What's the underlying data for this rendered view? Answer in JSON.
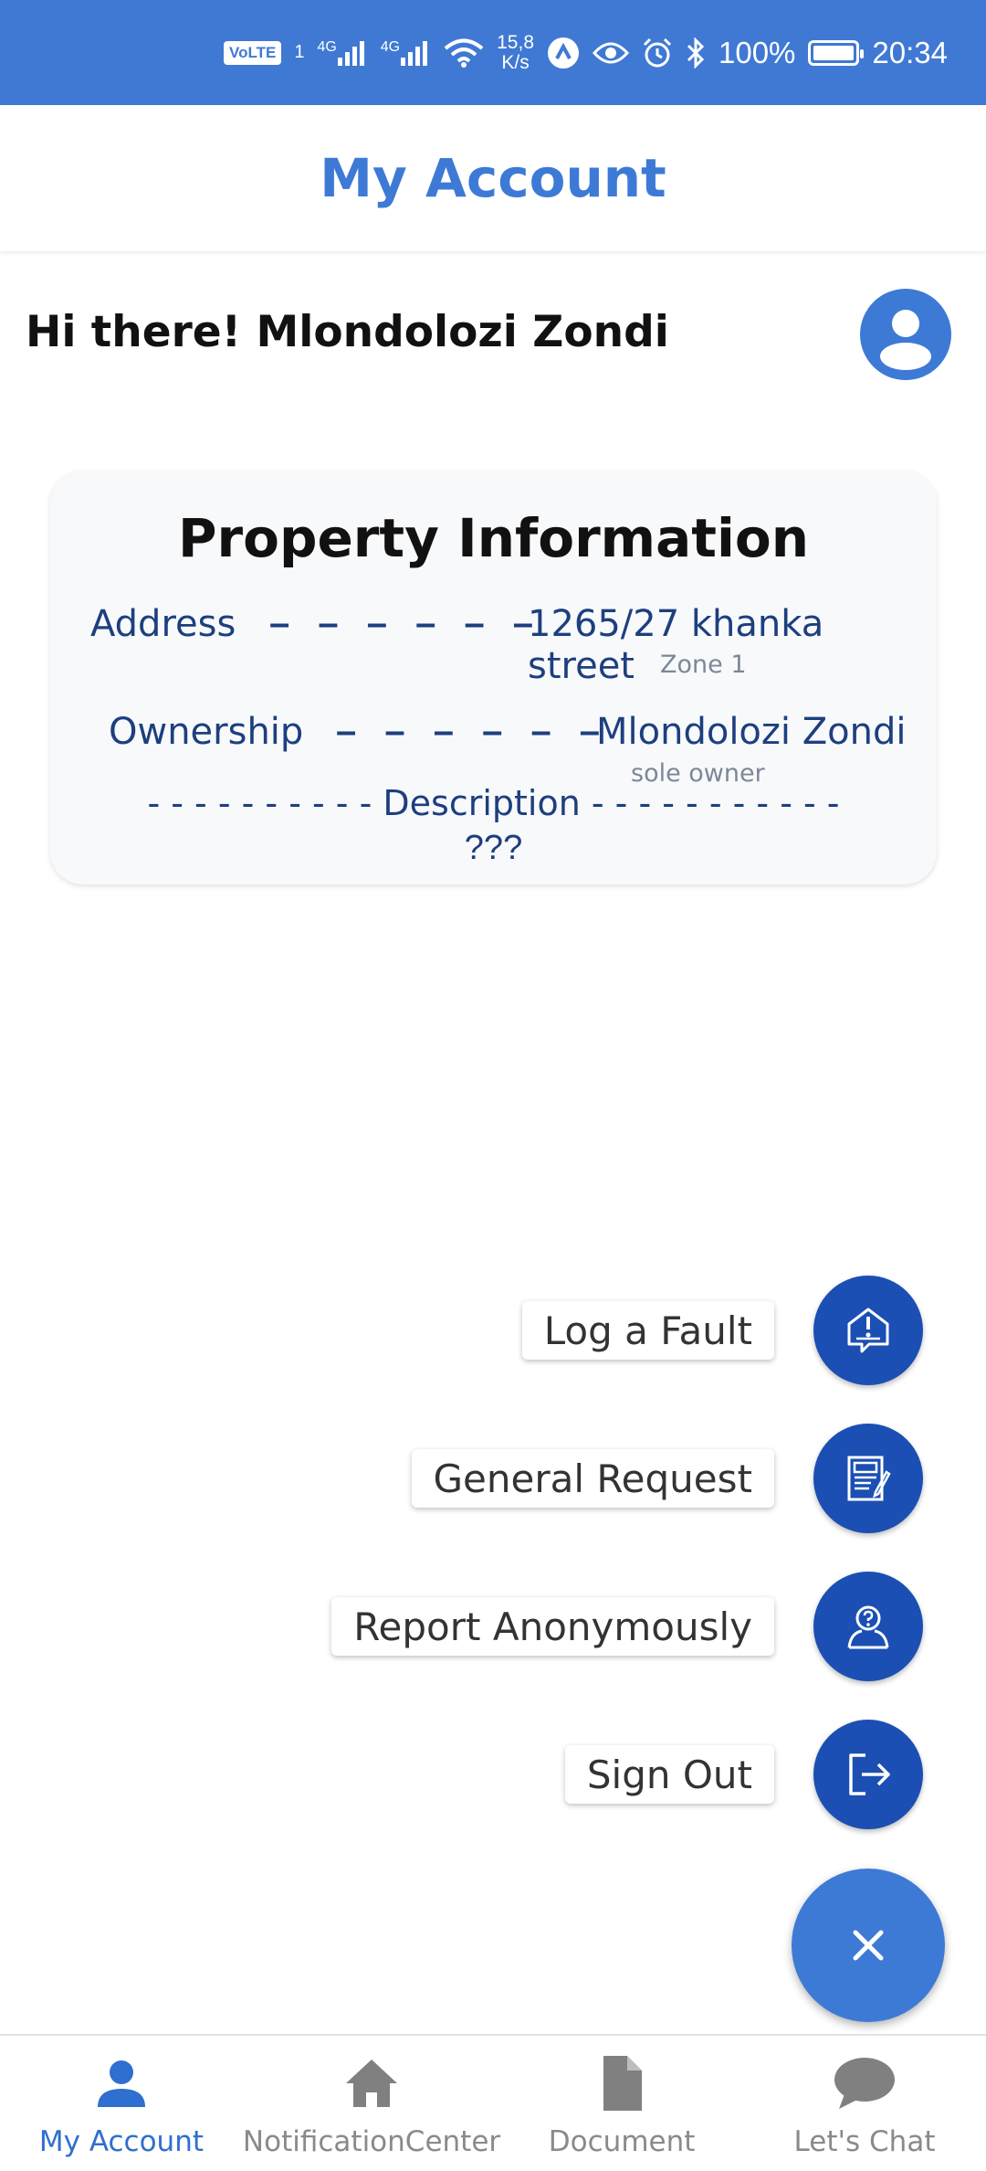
{
  "status_bar": {
    "volte": "VoLTE",
    "sim_marker": "1",
    "net1": "4G",
    "net2": "4G",
    "speed_value": "15,8",
    "speed_unit": "K/s",
    "battery": "100%",
    "time": "20:34",
    "icons": [
      "signal-icon",
      "wifi-icon",
      "app-notification-icon",
      "eye-icon",
      "alarm-icon",
      "bluetooth-icon",
      "battery-icon"
    ]
  },
  "header": {
    "title": "My Account"
  },
  "greeting": {
    "text": "Hi there! Mlondolozi Zondi"
  },
  "property": {
    "title": "Property Information",
    "address_label": "Address",
    "address_dashes": "– – – – – –",
    "address_value": "1265/27 khanka street",
    "address_sub": "Zone 1",
    "ownership_label": "Ownership",
    "ownership_dashes": "– – – – – –",
    "ownership_value": "Mlondolozi Zondi",
    "ownership_sub": "sole owner",
    "description_line": "- - - - - - - - - - Description - - - - - - - - - - -",
    "description_value": "???"
  },
  "fab_menu": {
    "items": [
      {
        "label": "Log a Fault",
        "icon": "fault-alert-icon"
      },
      {
        "label": "General Request",
        "icon": "request-form-icon"
      },
      {
        "label": "Report Anonymously",
        "icon": "anonymous-person-icon"
      },
      {
        "label": "Sign Out",
        "icon": "sign-out-icon"
      }
    ],
    "close_icon": "close-icon"
  },
  "bottom_nav": {
    "items": [
      {
        "label": "My Account",
        "icon": "person-icon",
        "active": true
      },
      {
        "label": "NotificationCenter",
        "icon": "home-icon",
        "active": false
      },
      {
        "label": "Document",
        "icon": "document-icon",
        "active": false
      },
      {
        "label": "Let's Chat",
        "icon": "chat-bubble-icon",
        "active": false
      }
    ]
  },
  "colors": {
    "status_bar": "#3f79d4",
    "accent": "#3d7ad6",
    "fab_dark": "#1b4fb3",
    "card_text": "#1d3f7e",
    "nav_active": "#2f6fcf",
    "nav_inactive": "#8a8a8a"
  }
}
